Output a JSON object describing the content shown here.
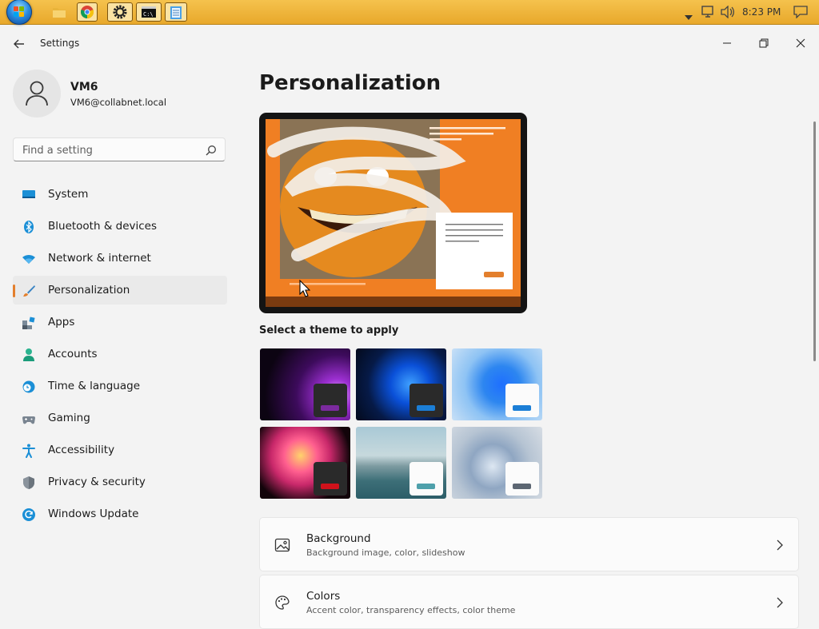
{
  "taskbar": {
    "clock": "8:23 PM",
    "apps": [
      "file-explorer",
      "chrome",
      "settings",
      "command-prompt",
      "notepad"
    ]
  },
  "window": {
    "title": "Settings"
  },
  "user": {
    "name": "VM6",
    "email": "VM6@collabnet.local"
  },
  "search": {
    "placeholder": "Find a setting"
  },
  "sidebar": {
    "items": [
      {
        "label": "System",
        "icon": "monitor-icon"
      },
      {
        "label": "Bluetooth & devices",
        "icon": "bluetooth-icon"
      },
      {
        "label": "Network & internet",
        "icon": "wifi-icon"
      },
      {
        "label": "Personalization",
        "icon": "brush-icon",
        "selected": true
      },
      {
        "label": "Apps",
        "icon": "apps-icon"
      },
      {
        "label": "Accounts",
        "icon": "person-icon"
      },
      {
        "label": "Time & language",
        "icon": "globe-clock-icon"
      },
      {
        "label": "Gaming",
        "icon": "gamepad-icon"
      },
      {
        "label": "Accessibility",
        "icon": "accessibility-icon"
      },
      {
        "label": "Privacy & security",
        "icon": "shield-icon"
      },
      {
        "label": "Windows Update",
        "icon": "refresh-icon"
      }
    ]
  },
  "main": {
    "title": "Personalization",
    "theme_section_label": "Select a theme to apply",
    "cards": [
      {
        "title": "Background",
        "subtitle": "Background image, color, slideshow",
        "icon": "image-icon"
      },
      {
        "title": "Colors",
        "subtitle": "Accent color, transparency effects, color theme",
        "icon": "palette-icon"
      }
    ]
  },
  "colors": {
    "accent": "#e37f2d",
    "taskbar": "#f0b53c"
  }
}
